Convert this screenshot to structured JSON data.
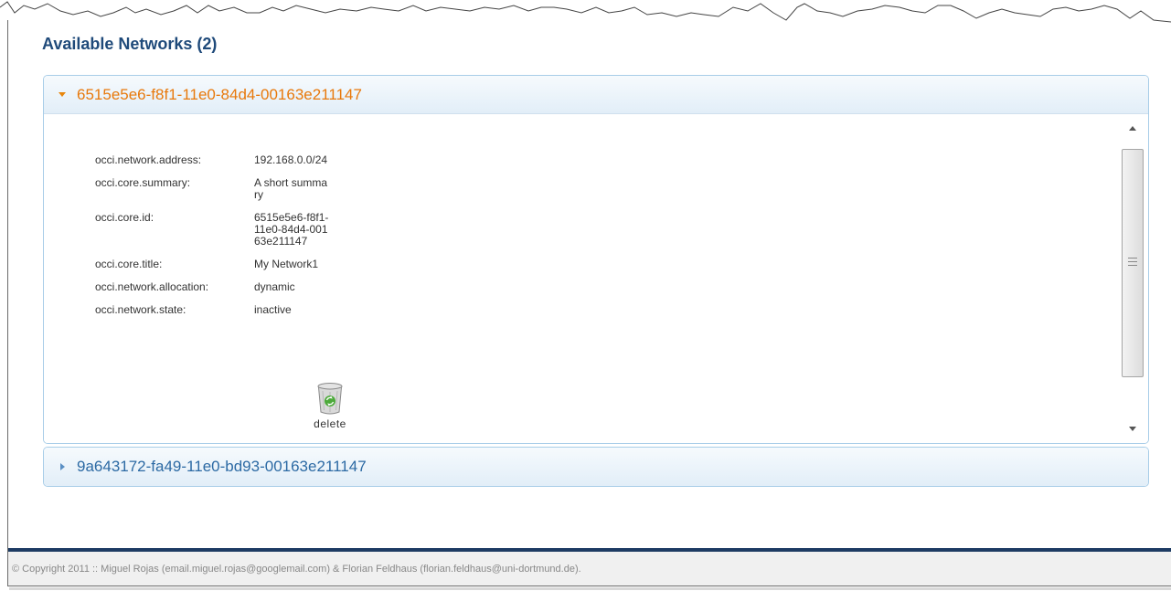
{
  "section": {
    "title": "Available Networks (2)"
  },
  "networks": [
    {
      "id_label": "6515e5e6-f8f1-11e0-84d4-00163e211147",
      "expanded": true,
      "properties": [
        {
          "key": "occi.network.address:",
          "value": "192.168.0.0/24"
        },
        {
          "key": "occi.core.summary:",
          "value": "A short summary"
        },
        {
          "key": "occi.core.id:",
          "value": "6515e5e6-f8f1-11e0-84d4-00163e211147"
        },
        {
          "key": "occi.core.title:",
          "value": "My Network1"
        },
        {
          "key": "occi.network.allocation:",
          "value": "dynamic"
        },
        {
          "key": "occi.network.state:",
          "value": "inactive"
        }
      ],
      "delete_label": "delete"
    },
    {
      "id_label": "9a643172-fa49-11e0-bd93-00163e211147",
      "expanded": false
    }
  ],
  "icons": {
    "expanded_arrow": "triangle-down-icon",
    "collapsed_arrow": "triangle-right-icon",
    "delete": "trash-icon",
    "scroll_grip": "grip-icon"
  },
  "colors": {
    "active_header_text": "#e8790c",
    "inactive_header_text": "#2c6aa4",
    "section_title": "#1f4a7a",
    "footer_bar": "#1d3b63"
  },
  "footer": {
    "copyright": "© Copyright 2011 :: Miguel Rojas (email.miguel.rojas@googlemail.com) & Florian Feldhaus (florian.feldhaus@uni-dortmund.de)."
  }
}
